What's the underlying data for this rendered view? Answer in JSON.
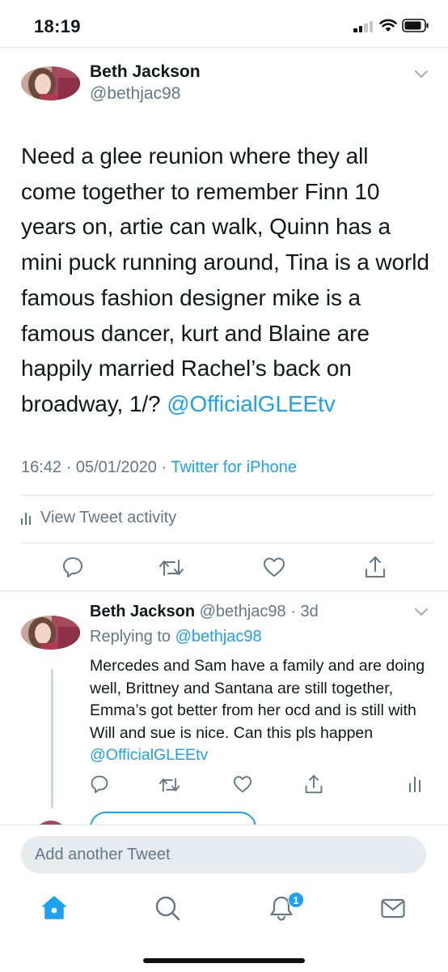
{
  "status_bar": {
    "time": "18:19"
  },
  "tweet": {
    "author_name": "Beth Jackson",
    "author_handle": "@bethjac98",
    "text": "Need a glee reunion where they all come together to remember Finn 10 years on, artie can walk, Quinn has a mini puck running around, Tina is a world famous fashion designer mike is a famous dancer, kurt and Blaine are happily married Rachel’s back on broadway, 1/? ",
    "mention": "@OfficialGLEEtv",
    "timestamp": "16:42 · 05/01/2020 · ",
    "source": "Twitter for iPhone",
    "activity_label": "View Tweet activity"
  },
  "reply": {
    "author_name": "Beth Jackson",
    "author_handle": "@bethjac98",
    "age": " · 3d",
    "replying_prefix": "Replying to ",
    "replying_to": "@bethjac98",
    "text": "Mercedes and Sam have a family and are doing well, Brittney and Santana are still together, Emma’s got better from her ocd and is still with Will and sue is nice. Can this pls happen ",
    "mention": "@OfficialGLEEtv"
  },
  "compose": {
    "placeholder": "Add another Tweet"
  },
  "tab_bar": {
    "items": [
      "home-icon",
      "search-icon",
      "notifications-icon",
      "messages-icon"
    ],
    "notification_count": "1"
  },
  "colors": {
    "accent": "#1da1f2",
    "secondary_text": "#657786",
    "icon_gray": "#657786"
  }
}
